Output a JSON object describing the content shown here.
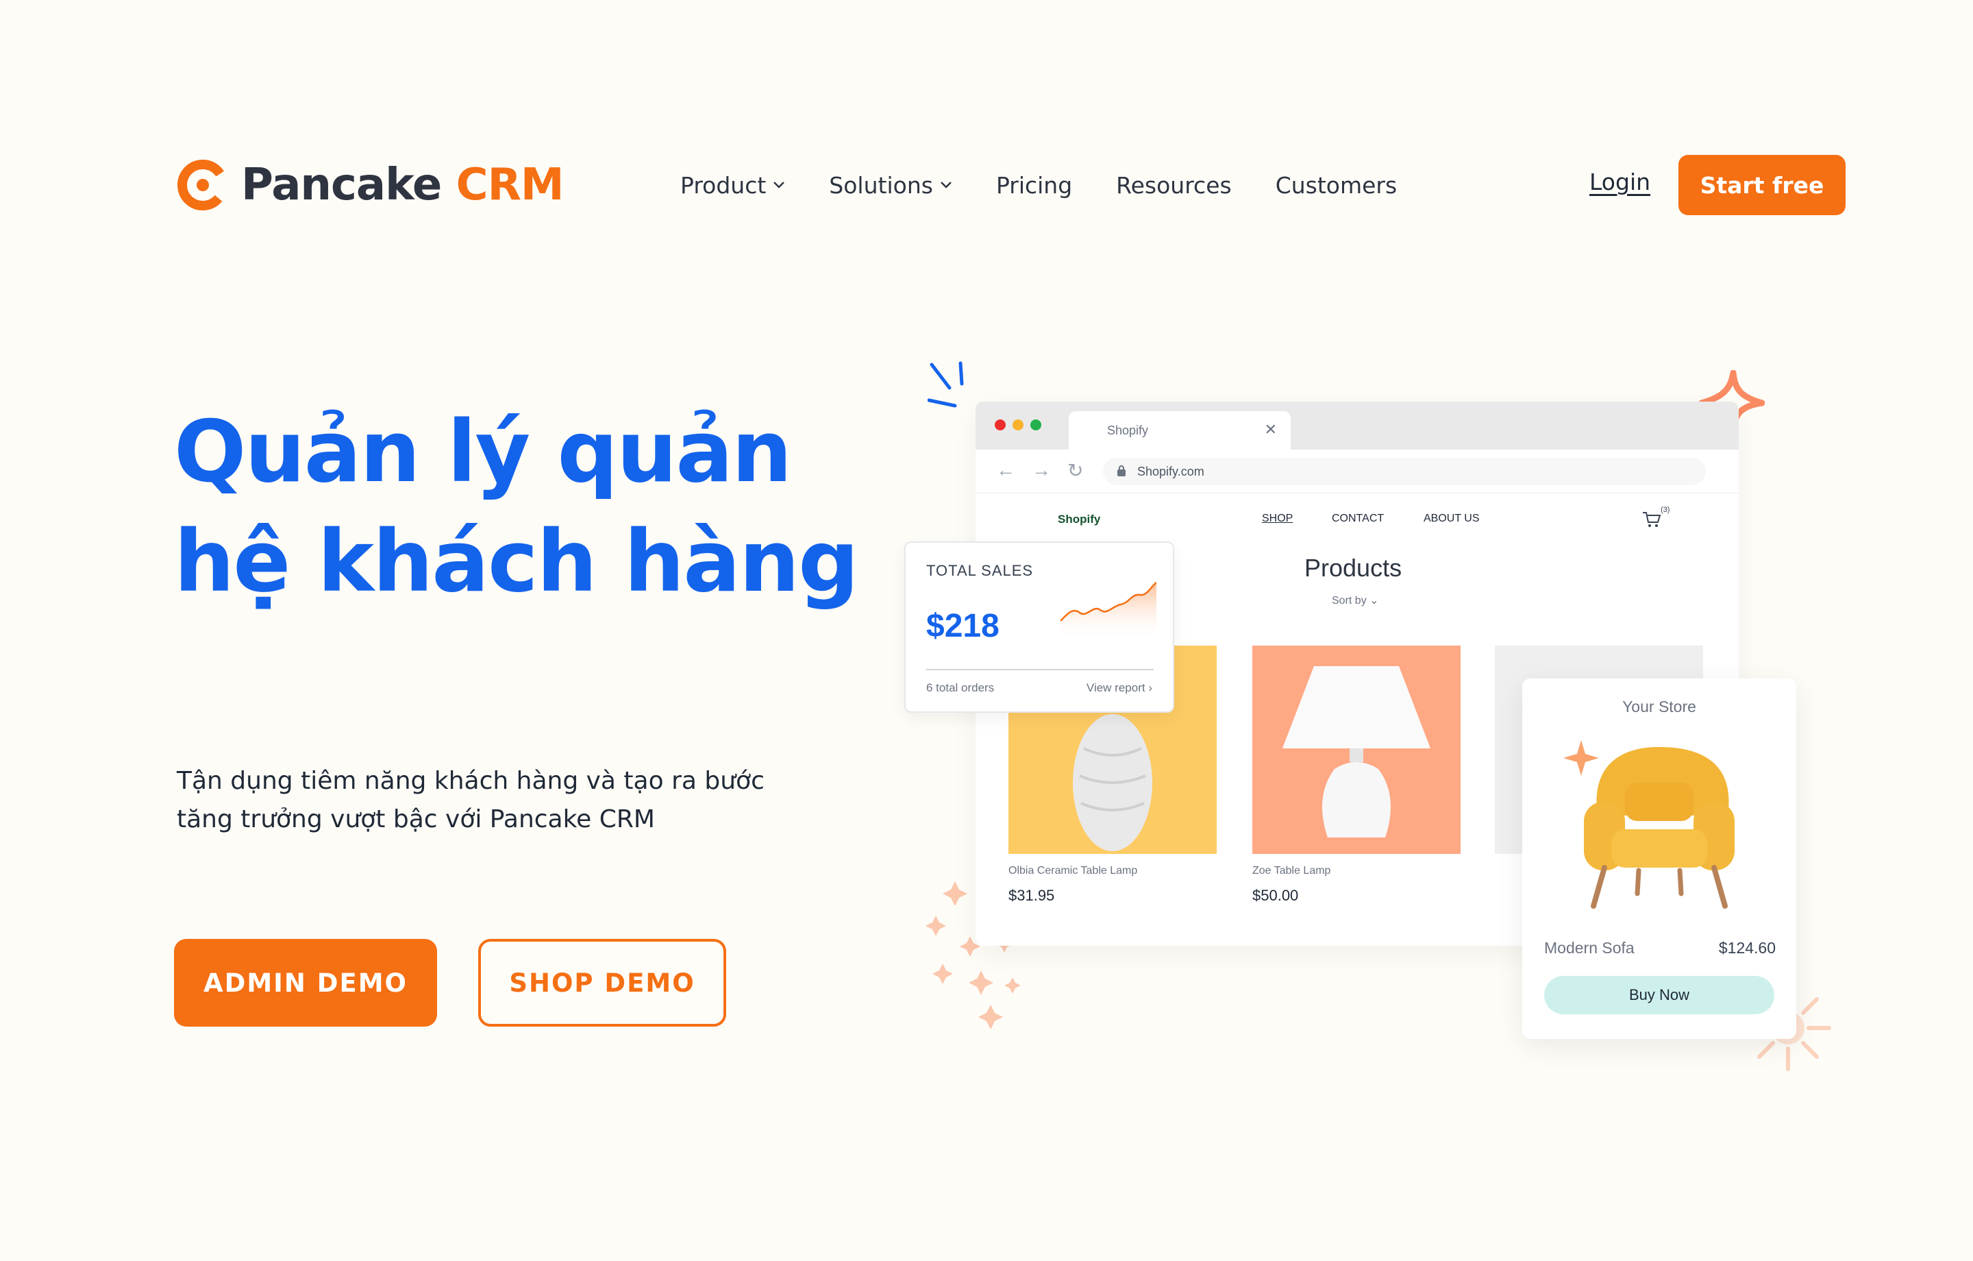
{
  "brand": {
    "name": "Pancake",
    "suffix": "CRM",
    "accent": "#f56f13"
  },
  "nav": {
    "items": [
      {
        "label": "Product"
      },
      {
        "label": "Solutions"
      },
      {
        "label": "Pricing"
      },
      {
        "label": "Resources"
      },
      {
        "label": "Customers"
      }
    ],
    "login": "Login",
    "cta": "Start free"
  },
  "hero": {
    "headline_line1": "Quản lý quản",
    "headline_line2": "hệ khách hàng",
    "sub_line1": "Tận dụng tiêm năng khách hàng và tạo ra bước",
    "sub_line2": "tăng trưởng vượt bậc với Pancake CRM",
    "admin_demo": "ADMIN DEMO",
    "shop_demo": "SHOP DEMO",
    "headline_color": "#1463eb"
  },
  "browser": {
    "tab_title": "Shopify",
    "url": "Shopify.com",
    "shop_brand": "Shopify",
    "shop_nav": [
      "SHOP",
      "CONTACT",
      "ABOUT US"
    ],
    "cart_count": "(3)",
    "products_title": "Products",
    "sort_by": "Sort by",
    "products": [
      {
        "name": "Olbia Ceramic Table Lamp",
        "price": "$31.95",
        "bg": "#fdcb64"
      },
      {
        "name": "Zoe Table Lamp",
        "price": "$50.00",
        "bg": "#fea884"
      }
    ]
  },
  "sales_card": {
    "label": "TOTAL SALES",
    "value": "$218",
    "orders": "6 total orders",
    "report": "View report"
  },
  "store_card": {
    "title": "Your Store",
    "product": "Modern Sofa",
    "price": "$124.60",
    "buy": "Buy Now"
  }
}
